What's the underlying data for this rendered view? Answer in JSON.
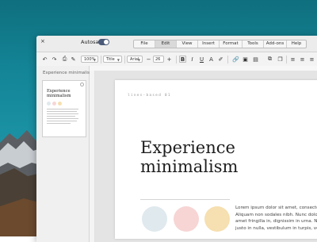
{
  "window": {
    "close_label": "×",
    "autosave_label": "Autosave",
    "autosave_on": true
  },
  "menu": {
    "items": [
      "File",
      "Edit",
      "View",
      "Insert",
      "Format",
      "Tools",
      "Add-ons",
      "Help"
    ],
    "active": "Edit"
  },
  "toolbar": {
    "zoom": "100%",
    "style": "Title",
    "font": "Arial",
    "font_size": "26",
    "decrease_size": "−",
    "increase_size": "+",
    "bold": "B",
    "italic": "I",
    "underline": "U",
    "text_color": "A"
  },
  "sidebar": {
    "title": "Experience minimalism",
    "thumbnail_title": "Experience minimalism"
  },
  "document": {
    "label": "lines-based 01",
    "headline_line1": "Experience",
    "headline_line2": "minimalism",
    "swatches": [
      "#dfe9ee",
      "#f7d5d5",
      "#f6dfb0"
    ],
    "body_lines": [
      "Lorem ipsum dolor sit amet, consectetur adip",
      "Aliquam non sodales nibh. Nunc dolor nunc, v",
      "amet fringilla in, dignissim in urna. Nulla aliqu",
      "justo in nulla, vestibulum in turpis, vestibulum"
    ]
  }
}
